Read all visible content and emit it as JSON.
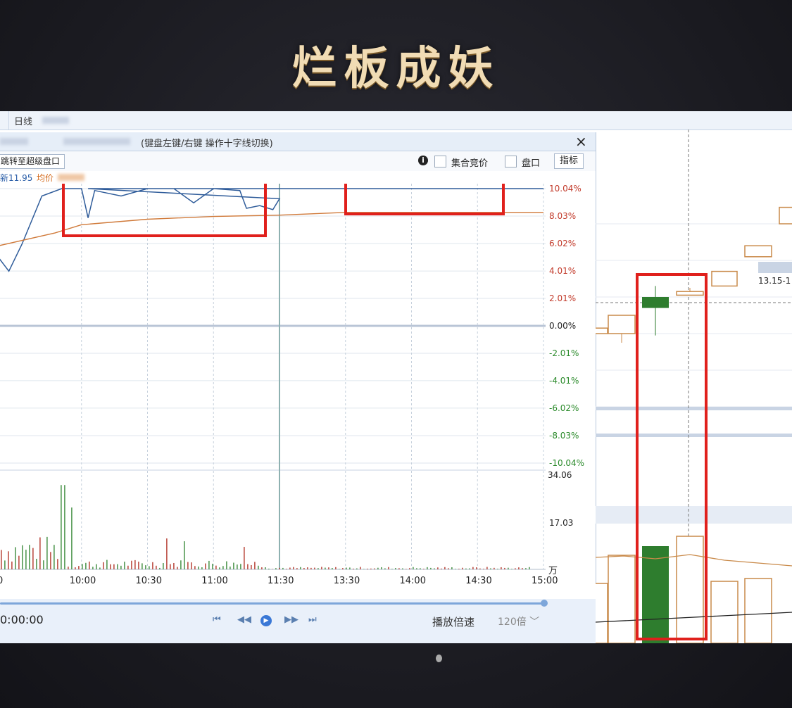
{
  "slide": {
    "title": "烂板成妖"
  },
  "tabs": {
    "daily": "日线"
  },
  "dialog": {
    "hint": "(键盘左键/右键 操作十字线切换)",
    "close": "×",
    "super_btn": "跳转至超级盘口",
    "auction_label": "集合竞价",
    "handicap_label": "盘口",
    "indicator_btn": "指标",
    "info_icon": "i",
    "price_now": "新11.95",
    "price_avg": "均价"
  },
  "chart_data": {
    "type": "line",
    "x_ticks": [
      "10:00",
      "10:30",
      "11:00",
      "11:30",
      "13:30",
      "14:00",
      "14:30",
      "15:00"
    ],
    "pct_ticks": [
      "10.04%",
      "8.03%",
      "6.02%",
      "4.01%",
      "2.01%",
      "0.00%",
      "-2.01%",
      "-4.01%",
      "-6.02%",
      "-8.03%",
      "-10.04%"
    ],
    "pct_values": [
      10.04,
      8.03,
      6.02,
      4.01,
      2.01,
      0.0,
      -2.01,
      -4.01,
      -6.02,
      -8.03,
      -10.04
    ],
    "volume_ticks": [
      "34.06",
      "17.03",
      "万"
    ],
    "volume_max": 34.06,
    "ylim": [
      -10.04,
      10.04
    ],
    "price_series": [
      [
        9.3,
        5.9
      ],
      [
        9.45,
        4.0
      ],
      [
        9.55,
        6.0
      ],
      [
        9.7,
        9.5
      ],
      [
        9.85,
        10.04
      ],
      [
        10.0,
        10.04
      ],
      [
        10.05,
        7.9
      ],
      [
        10.1,
        9.9
      ],
      [
        10.3,
        9.5
      ],
      [
        10.5,
        10.04
      ],
      [
        10.7,
        10.04
      ],
      [
        10.85,
        9.0
      ],
      [
        11.0,
        10.04
      ],
      [
        11.2,
        9.9
      ],
      [
        11.25,
        8.6
      ],
      [
        11.35,
        8.8
      ],
      [
        11.45,
        8.5
      ],
      [
        11.5,
        9.3
      ],
      [
        11.55,
        10.04
      ],
      [
        12.0,
        10.04
      ],
      [
        13.5,
        10.04
      ],
      [
        15.0,
        10.04
      ]
    ],
    "avg_series": [
      [
        9.3,
        5.7
      ],
      [
        9.8,
        6.8
      ],
      [
        10.0,
        7.4
      ],
      [
        10.5,
        7.8
      ],
      [
        11.0,
        8.0
      ],
      [
        11.5,
        8.1
      ],
      [
        13.5,
        8.3
      ],
      [
        15.0,
        8.3
      ]
    ],
    "volume": [
      2,
      3,
      4,
      5,
      6,
      7,
      8,
      9,
      10,
      11,
      12,
      13,
      14
    ],
    "right_candles": [
      {
        "open": 0.3,
        "close": 0.0,
        "high": 0.4,
        "low": -0.1,
        "color": "hollow"
      },
      {
        "open": 1.0,
        "close": 0.0,
        "high": 1.0,
        "low": -0.5,
        "color": "hollow"
      },
      {
        "open": 2.0,
        "close": 1.4,
        "high": 2.6,
        "low": -0.1,
        "color": "green"
      },
      {
        "open": 2.1,
        "close": 2.3,
        "high": 2.5,
        "low": 2.1,
        "color": "hollow"
      },
      {
        "open": 2.6,
        "close": 3.4,
        "high": 3.4,
        "low": 2.6,
        "color": "hollow"
      },
      {
        "open": 4.2,
        "close": 4.8,
        "high": 4.8,
        "low": 4.2,
        "color": "hollow"
      },
      {
        "open": 6.0,
        "close": 6.9,
        "high": 6.9,
        "low": 6.0,
        "color": "hollow"
      }
    ],
    "right_label": "13.15-1"
  },
  "playback": {
    "time": "0:00:00",
    "speed_label": "播放倍速",
    "speed_value": "120倍 ﹀"
  }
}
